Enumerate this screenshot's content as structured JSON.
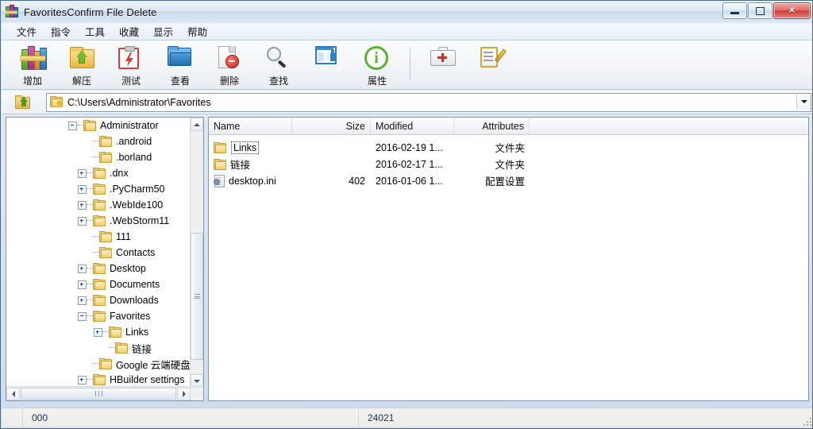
{
  "window": {
    "title": "FavoritesConfirm File Delete",
    "icon": "winrar-icon",
    "buttons": {
      "minimize": "minimize-button",
      "maximize": "maximize-button",
      "close": "✕"
    }
  },
  "menubar": {
    "items": [
      {
        "label": "文件"
      },
      {
        "label": "指令"
      },
      {
        "label": "工具"
      },
      {
        "label": "收藏"
      },
      {
        "label": "显示"
      },
      {
        "label": "帮助"
      }
    ]
  },
  "toolbar": {
    "buttons": [
      {
        "label": "增加",
        "icon": "add-archive-icon"
      },
      {
        "label": "解压",
        "icon": "extract-icon"
      },
      {
        "label": "测试",
        "icon": "test-icon"
      },
      {
        "label": "查看",
        "icon": "view-icon"
      },
      {
        "label": "删除",
        "icon": "delete-icon"
      },
      {
        "label": "查找",
        "icon": "find-icon"
      },
      {
        "label": "",
        "icon": "wizard-icon"
      },
      {
        "label": "属性",
        "icon": "info-icon"
      }
    ],
    "extra_buttons": [
      {
        "label": "",
        "icon": "repair-icon"
      },
      {
        "label": "",
        "icon": "comment-icon"
      }
    ]
  },
  "address": {
    "up_icon": "up-one-level-icon",
    "folder_icon": "favorites-folder-icon",
    "path": "C:\\Users\\Administrator\\Favorites",
    "dropdown_icon": "chevron-down-icon"
  },
  "tree": {
    "items": [
      {
        "label": "Administrator",
        "indent": 0,
        "state": "minus"
      },
      {
        "label": ".android",
        "indent": 1,
        "state": "none"
      },
      {
        "label": ".borland",
        "indent": 1,
        "state": "none"
      },
      {
        "label": ".dnx",
        "indent": 1,
        "state": "plus"
      },
      {
        "label": ".PyCharm50",
        "indent": 1,
        "state": "plus"
      },
      {
        "label": ".WebIde100",
        "indent": 1,
        "state": "plus"
      },
      {
        "label": ".WebStorm11",
        "indent": 1,
        "state": "plus"
      },
      {
        "label": "111",
        "indent": 1,
        "state": "none"
      },
      {
        "label": "Contacts",
        "indent": 1,
        "state": "none"
      },
      {
        "label": "Desktop",
        "indent": 1,
        "state": "plus"
      },
      {
        "label": "Documents",
        "indent": 1,
        "state": "plus"
      },
      {
        "label": "Downloads",
        "indent": 1,
        "state": "plus"
      },
      {
        "label": "Favorites",
        "indent": 1,
        "state": "minus"
      },
      {
        "label": "Links",
        "indent": 2,
        "state": "plus"
      },
      {
        "label": "链接",
        "indent": 2,
        "state": "none"
      },
      {
        "label": "Google 云端硬盘",
        "indent": 1,
        "state": "none"
      },
      {
        "label": "HBuilder settings",
        "indent": 1,
        "state": "plus"
      }
    ]
  },
  "filelist": {
    "columns": [
      {
        "label": "Name",
        "align": "left"
      },
      {
        "label": "Size",
        "align": "right"
      },
      {
        "label": "Modified",
        "align": "left"
      },
      {
        "label": "Attributes",
        "align": "right"
      }
    ],
    "rows": [
      {
        "name": "Links",
        "size": "",
        "modified": "2016-02-19 1...",
        "attributes": "文件夹",
        "icon": "folder-icon",
        "focused": true
      },
      {
        "name": "链接",
        "size": "",
        "modified": "2016-02-17 1...",
        "attributes": "文件夹",
        "icon": "folder-icon",
        "focused": false
      },
      {
        "name": "desktop.ini",
        "size": "402",
        "modified": "2016-01-06 1...",
        "attributes": "配置设置",
        "icon": "ini-file-icon",
        "focused": false
      }
    ]
  },
  "statusbar": {
    "left": "000",
    "right": "24021"
  },
  "colors": {
    "accent": "#2f7fc0",
    "titlebar": "#dfe9f4",
    "close_button": "#c93d36",
    "folder": "#e8bc55",
    "status_text": "#14314e"
  }
}
